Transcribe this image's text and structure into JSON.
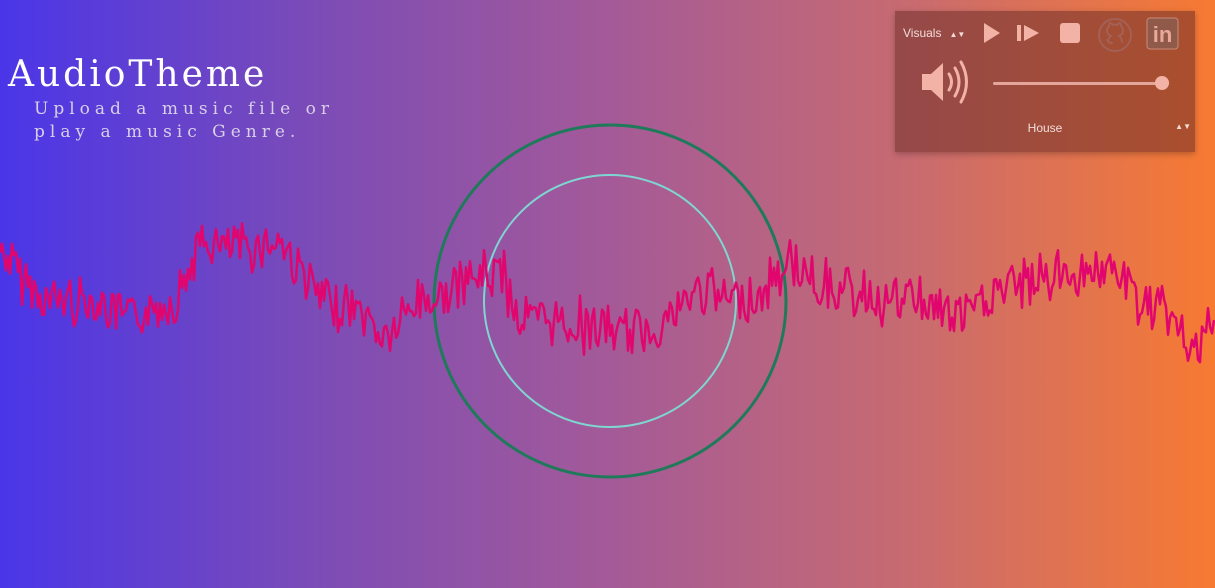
{
  "app": {
    "title": "AudioTheme",
    "subtitle": "Upload a music file or play a music Genre."
  },
  "controls": {
    "visuals_label": "Visuals",
    "select_arrows": "▲▼",
    "play_icon": "play-icon",
    "skip_icon": "skip-icon",
    "stop_icon": "stop-icon",
    "github_icon": "github-icon",
    "linkedin_icon": "linkedin-icon",
    "linkedin_text": "in",
    "volume_icon": "volume-icon",
    "volume_level": 0.96,
    "genre": "House"
  },
  "colors": {
    "gradient_start": "#4a36e8",
    "gradient_end": "#f77a32",
    "waveform": "#e0066e",
    "outer_ring": "#1f7a5a",
    "inner_ring": "#7fd6d0",
    "panel_icon": "#f2b3a6"
  }
}
